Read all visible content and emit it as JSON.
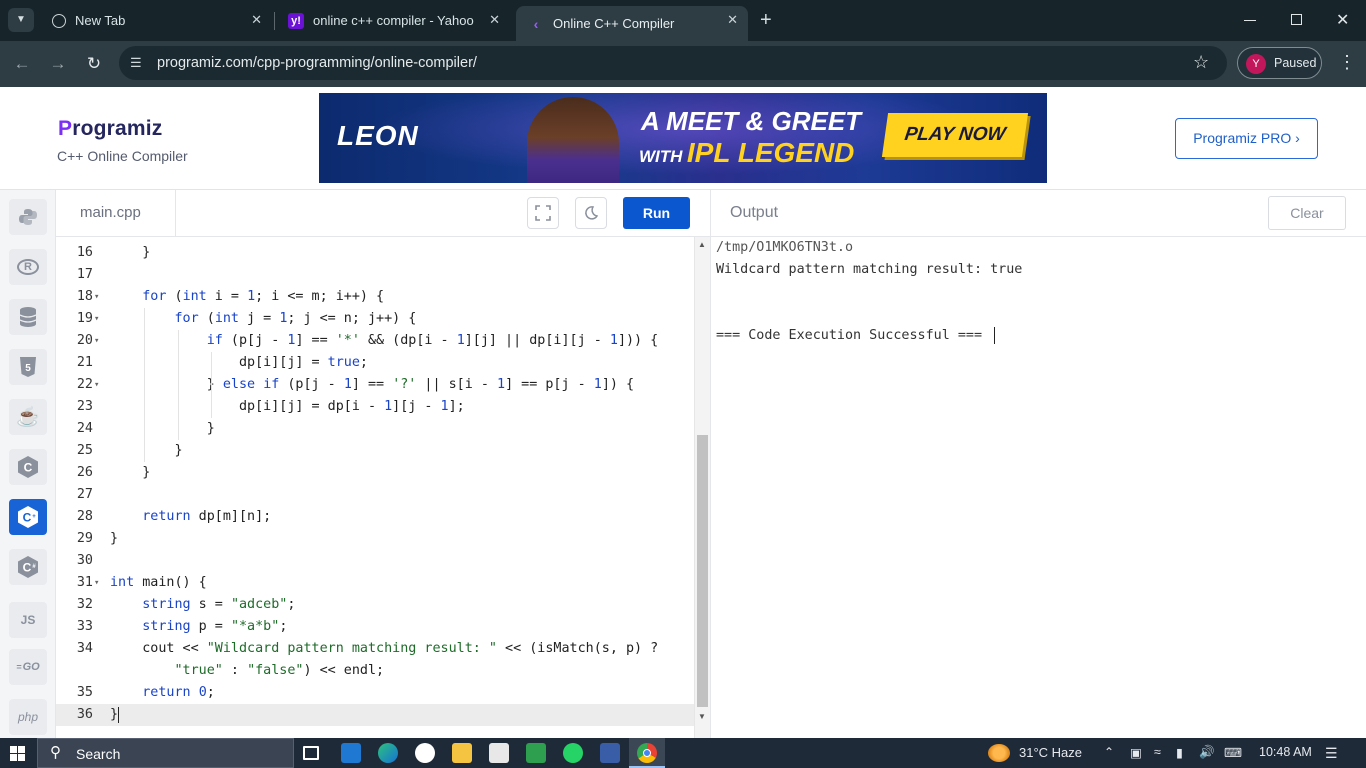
{
  "browser": {
    "tabs": [
      {
        "title": "New Tab"
      },
      {
        "title": "online c++ compiler - Yahoo In"
      },
      {
        "title": "Online C++ Compiler"
      }
    ],
    "new_tab_symbol": "+",
    "url": "programiz.com/cpp-programming/online-compiler/",
    "profile_initial": "Y",
    "profile_status": "Paused"
  },
  "header": {
    "logo_text": "rogramiz",
    "logo_letter": "P",
    "subtitle": "C++ Online Compiler",
    "ad": {
      "brand": "LEON",
      "headline1": "A MEET & GREET",
      "headline2_small": "WITH",
      "headline2_big": "IPL LEGEND",
      "cta": "PLAY NOW"
    },
    "pro_button": "Programiz PRO ›"
  },
  "sidebar": {
    "languages": [
      {
        "name": "python-icon",
        "glyph": "🐍"
      },
      {
        "name": "r-icon",
        "glyph": "R"
      },
      {
        "name": "sql-icon",
        "glyph": "▤"
      },
      {
        "name": "html-icon",
        "glyph": "5"
      },
      {
        "name": "java-icon",
        "glyph": "☕"
      },
      {
        "name": "c-icon",
        "glyph": "C"
      },
      {
        "name": "cpp-icon",
        "glyph": "C"
      },
      {
        "name": "csharp-icon",
        "glyph": "C"
      },
      {
        "name": "js-icon",
        "glyph": "JS"
      },
      {
        "name": "go-icon",
        "glyph": "GO"
      },
      {
        "name": "php-icon",
        "glyph": "php"
      }
    ]
  },
  "editor": {
    "filename": "main.cpp",
    "run_label": "Run",
    "lines": [
      {
        "n": "16",
        "fold": false,
        "text": "    }"
      },
      {
        "n": "17",
        "fold": false,
        "text": ""
      },
      {
        "n": "18",
        "fold": true,
        "text": "    for (int i = 1; i <= m; i++) {"
      },
      {
        "n": "19",
        "fold": true,
        "text": "        for (int j = 1; j <= n; j++) {"
      },
      {
        "n": "20",
        "fold": true,
        "text": "            if (p[j - 1] == '*' && (dp[i - 1][j] || dp[i][j - 1])) {"
      },
      {
        "n": "21",
        "fold": false,
        "text": "                dp[i][j] = true;"
      },
      {
        "n": "22",
        "fold": true,
        "text": "            } else if (p[j - 1] == '?' || s[i - 1] == p[j - 1]) {"
      },
      {
        "n": "23",
        "fold": false,
        "text": "                dp[i][j] = dp[i - 1][j - 1];"
      },
      {
        "n": "24",
        "fold": false,
        "text": "            }"
      },
      {
        "n": "25",
        "fold": false,
        "text": "        }"
      },
      {
        "n": "26",
        "fold": false,
        "text": "    }"
      },
      {
        "n": "27",
        "fold": false,
        "text": ""
      },
      {
        "n": "28",
        "fold": false,
        "text": "    return dp[m][n];"
      },
      {
        "n": "29",
        "fold": false,
        "text": "}"
      },
      {
        "n": "30",
        "fold": false,
        "text": ""
      },
      {
        "n": "31",
        "fold": true,
        "text": "int main() {"
      },
      {
        "n": "32",
        "fold": false,
        "text": "    string s = \"adceb\";"
      },
      {
        "n": "33",
        "fold": false,
        "text": "    string p = \"*a*b\";"
      },
      {
        "n": "34",
        "fold": false,
        "text": "    cout << \"Wildcard pattern matching result: \" << (isMatch(s, p) ?"
      },
      {
        "n": "",
        "fold": false,
        "text": "        \"true\" : \"false\") << endl;"
      },
      {
        "n": "35",
        "fold": false,
        "text": "    return 0;"
      },
      {
        "n": "36",
        "fold": false,
        "text": "}"
      }
    ]
  },
  "output": {
    "title": "Output",
    "clear_label": "Clear",
    "lines": [
      "/tmp/O1MKO6TN3t.o",
      "Wildcard pattern matching result: true",
      "",
      "",
      "=== Code Execution Successful ==="
    ]
  },
  "taskbar": {
    "search_label": "Search",
    "weather": "31°C  Haze",
    "time": "10:48 AM"
  },
  "colors": {
    "accent": "#0b57d0",
    "chrome_dark": "#2e3c43",
    "logo_purple": "#7b2ff7"
  }
}
